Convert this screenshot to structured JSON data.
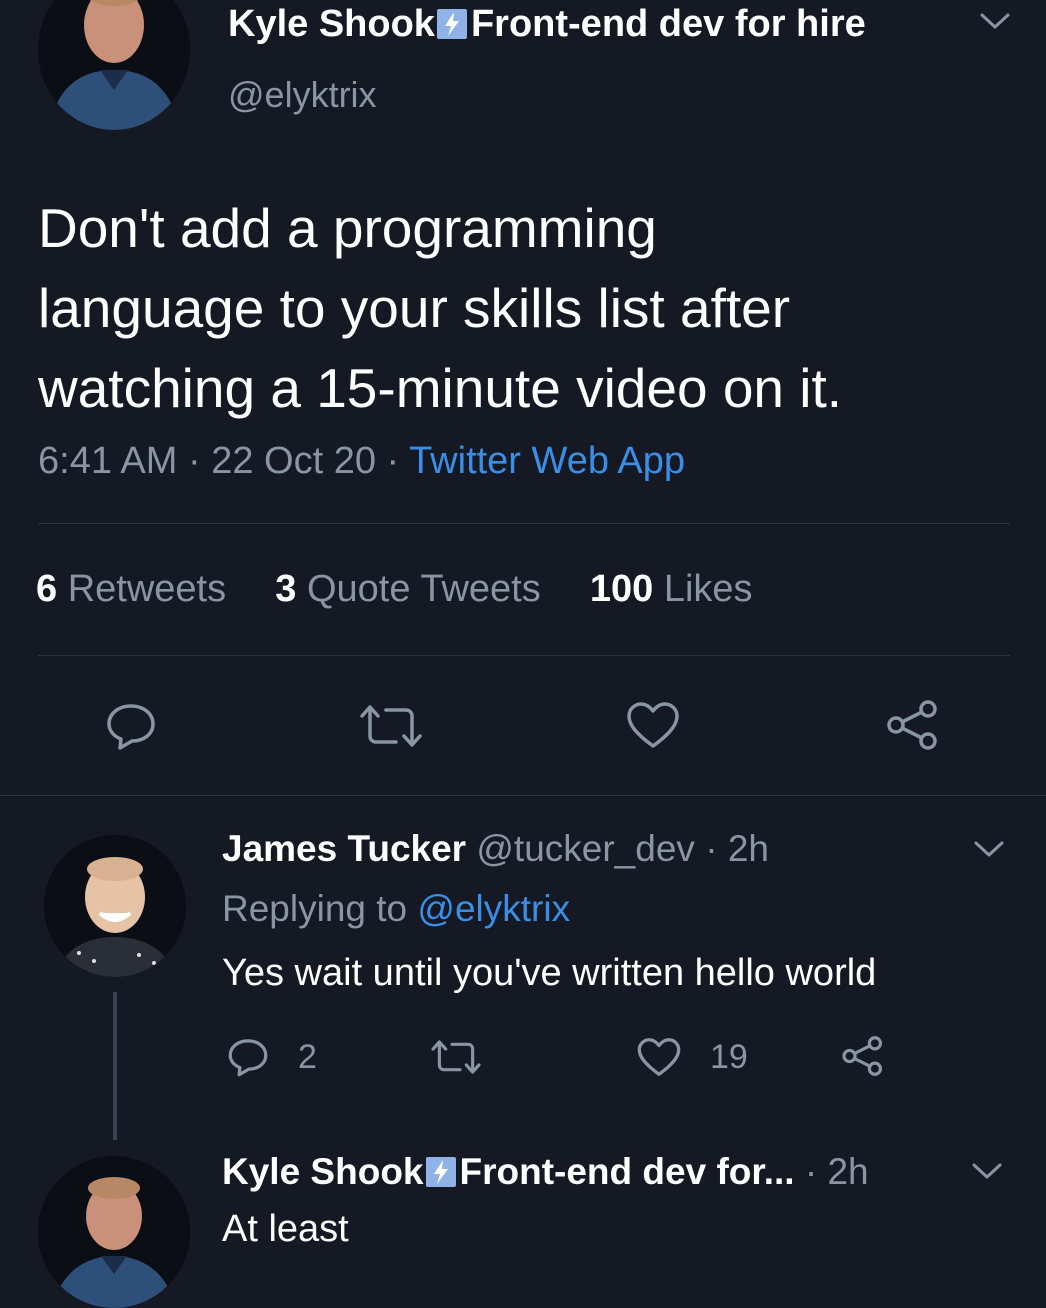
{
  "main_tweet": {
    "author_name": "Kyle Shook",
    "author_bio_tag": "Front-end dev for hire",
    "handle": "@elyktrix",
    "text_line1": "Don't add a programming",
    "text_line2": "language to your skills list after",
    "text_line3": "watching a 15-minute video on it.",
    "time": "6:41 AM",
    "date": "22 Oct 20",
    "source": "Twitter Web App",
    "retweets_count": "6",
    "retweets_label": "Retweets",
    "quotes_count": "3",
    "quotes_label": "Quote Tweets",
    "likes_count": "100",
    "likes_label": "Likes"
  },
  "reply1": {
    "author_name": "James Tucker",
    "handle": "@tucker_dev",
    "time": "2h",
    "replying_prefix": "Replying to",
    "replying_handle": "@elyktrix",
    "text": "Yes wait until you've written hello world",
    "reply_count": "2",
    "like_count": "19"
  },
  "reply2": {
    "author_name": "Kyle Shook",
    "author_bio_tag": "Front-end dev for...",
    "time": "2h",
    "text": "At least"
  },
  "separator": "·",
  "colors": {
    "background": "#141923",
    "muted": "#8a95a3",
    "link": "#3a8ee6",
    "divider": "#2a3340"
  },
  "icons": [
    "chevron-down-icon",
    "reply-icon",
    "retweet-icon",
    "like-icon",
    "share-icon",
    "lightning-icon"
  ]
}
